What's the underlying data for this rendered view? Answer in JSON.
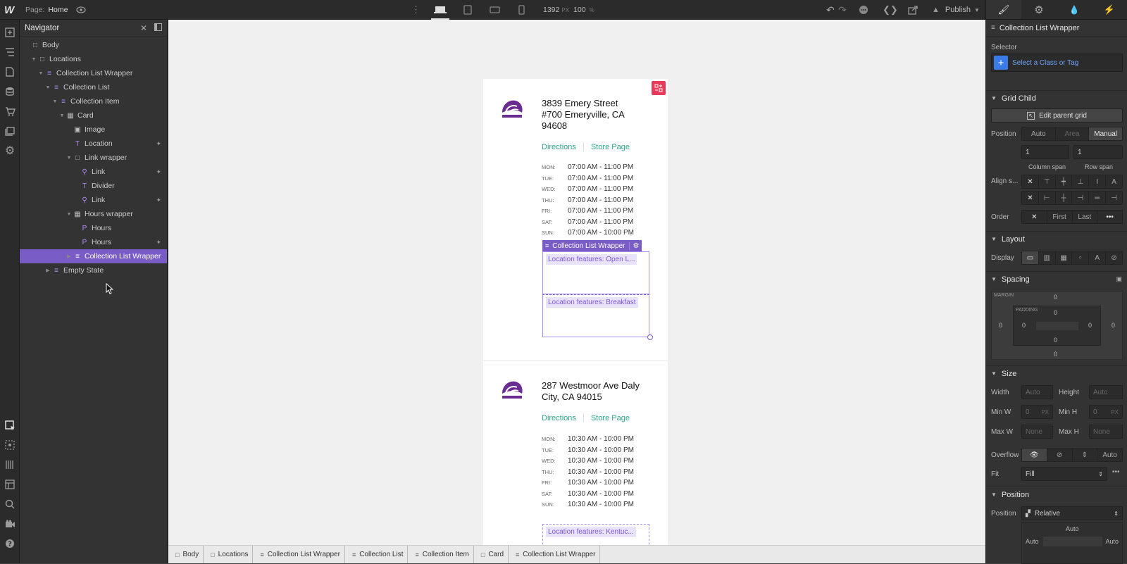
{
  "topbar": {
    "logo": "W",
    "page_prefix": "Page:",
    "page_name": "Home",
    "width_value": "1392",
    "width_unit": "PX",
    "zoom_value": "100",
    "zoom_unit": "%",
    "publish_label": "Publish"
  },
  "navigator": {
    "title": "Navigator",
    "items": [
      {
        "label": "Body",
        "depth": 0,
        "icon": "box",
        "arrow": ""
      },
      {
        "label": "Locations",
        "depth": 1,
        "icon": "box",
        "arrow": "▼"
      },
      {
        "label": "Collection List Wrapper",
        "depth": 2,
        "icon": "collection",
        "arrow": "▼"
      },
      {
        "label": "Collection List",
        "depth": 3,
        "icon": "collection",
        "arrow": "▼"
      },
      {
        "label": "Collection Item",
        "depth": 4,
        "icon": "collection",
        "arrow": "▼"
      },
      {
        "label": "Card",
        "depth": 5,
        "icon": "grid",
        "arrow": "▼"
      },
      {
        "label": "Image",
        "depth": 6,
        "icon": "image",
        "arrow": ""
      },
      {
        "label": "Location",
        "depth": 6,
        "icon": "text",
        "arrow": "",
        "pin": true
      },
      {
        "label": "Link wrapper",
        "depth": 6,
        "icon": "box",
        "arrow": "▼"
      },
      {
        "label": "Link",
        "depth": 7,
        "icon": "link",
        "arrow": "",
        "pin": true
      },
      {
        "label": "Divider",
        "depth": 7,
        "icon": "text",
        "arrow": ""
      },
      {
        "label": "Link",
        "depth": 7,
        "icon": "link",
        "arrow": "",
        "pin": true
      },
      {
        "label": "Hours wrapper",
        "depth": 6,
        "icon": "grid",
        "arrow": "▼"
      },
      {
        "label": "Hours",
        "depth": 7,
        "icon": "paragraph",
        "arrow": ""
      },
      {
        "label": "Hours",
        "depth": 7,
        "icon": "paragraph",
        "arrow": "",
        "pin": true
      },
      {
        "label": "Collection List Wrapper",
        "depth": 6,
        "icon": "collection",
        "arrow": "▶",
        "selected": true
      },
      {
        "label": "Empty State",
        "depth": 3,
        "icon": "collection",
        "arrow": "▶"
      }
    ]
  },
  "cards": [
    {
      "address": "3839 Emery Street #700 Emeryville, CA 94608",
      "directions": "Directions",
      "store_page": "Store Page",
      "hours": [
        {
          "day": "MON:",
          "time": "07:00 AM - 11:00 PM"
        },
        {
          "day": "TUE:",
          "time": "07:00 AM - 11:00 PM"
        },
        {
          "day": "WED:",
          "time": "07:00 AM - 11:00 PM"
        },
        {
          "day": "THU:",
          "time": "07:00 AM - 11:00 PM"
        },
        {
          "day": "FRI:",
          "time": "07:00 AM - 11:00 PM"
        },
        {
          "day": "SAT:",
          "time": "07:00 AM - 11:00 PM"
        },
        {
          "day": "SUN:",
          "time": "07:00 AM - 10:00 PM"
        }
      ],
      "features": [
        "Location features: Open L...",
        "Location features: Breakfast"
      ]
    },
    {
      "address": "287 Westmoor Ave Daly City, CA 94015",
      "directions": "Directions",
      "store_page": "Store Page",
      "hours": [
        {
          "day": "MON:",
          "time": "10:30 AM - 10:00 PM"
        },
        {
          "day": "TUE:",
          "time": "10:30 AM - 10:00 PM"
        },
        {
          "day": "WED:",
          "time": "10:30 AM - 10:00 PM"
        },
        {
          "day": "THU:",
          "time": "10:30 AM - 10:00 PM"
        },
        {
          "day": "FRI:",
          "time": "10:30 AM - 10:00 PM"
        },
        {
          "day": "SAT:",
          "time": "10:30 AM - 10:00 PM"
        },
        {
          "day": "SUN:",
          "time": "10:30 AM - 10:00 PM"
        }
      ],
      "features": [
        "Location features: Kentuc..."
      ]
    }
  ],
  "canvas": {
    "selected_label": "Collection List Wrapper"
  },
  "breadcrumbs": [
    "Body",
    "Locations",
    "Collection List Wrapper",
    "Collection List",
    "Collection Item",
    "Card",
    "Collection List Wrapper"
  ],
  "right_panel": {
    "element_name": "Collection List Wrapper",
    "selector_label": "Selector",
    "selector_placeholder": "Select a Class or Tag",
    "grid_child": {
      "title": "Grid Child",
      "edit_parent": "Edit parent grid",
      "position_label": "Position",
      "position_options": [
        "Auto",
        "Area",
        "Manual"
      ],
      "column_span_value": "1",
      "row_span_value": "1",
      "column_span_label": "Column span",
      "row_span_label": "Row span",
      "align_label": "Align s...",
      "order_label": "Order",
      "order_options": [
        "First",
        "Last"
      ]
    },
    "layout": {
      "title": "Layout",
      "display_label": "Display"
    },
    "spacing": {
      "title": "Spacing",
      "margin_label": "MARGIN",
      "padding_label": "PADDING",
      "margin": {
        "top": "0",
        "right": "0",
        "bottom": "0",
        "left": "0"
      },
      "padding": {
        "top": "0",
        "right": "0",
        "bottom": "0",
        "left": "0"
      }
    },
    "size": {
      "title": "Size",
      "width_label": "Width",
      "width_value": "Auto",
      "height_label": "Height",
      "height_value": "Auto",
      "min_w_label": "Min W",
      "min_w_value": "0",
      "min_w_unit": "PX",
      "min_h_label": "Min H",
      "min_h_value": "0",
      "min_h_unit": "PX",
      "max_w_label": "Max W",
      "max_w_value": "None",
      "max_h_label": "Max H",
      "max_h_value": "None",
      "overflow_label": "Overflow",
      "overflow_auto": "Auto",
      "fit_label": "Fit",
      "fit_value": "Fill"
    },
    "position": {
      "title": "Position",
      "position_label": "Position",
      "position_value": "Relative",
      "top_value": "Auto",
      "left_value": "Auto",
      "right_value": "Auto"
    }
  },
  "colors": {
    "accent_purple": "#7a5cc6",
    "link_teal": "#2ea48a",
    "blue_button": "#3b7be8",
    "pink_badge": "#e83b5a"
  }
}
